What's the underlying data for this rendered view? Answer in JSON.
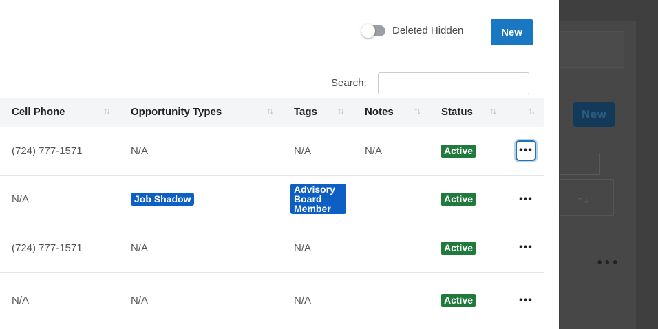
{
  "background": {
    "new_label": "New"
  },
  "toolbar": {
    "toggle_label": "Deleted Hidden",
    "new_label": "New",
    "search_label": "Search:",
    "search_value": ""
  },
  "table": {
    "headers": [
      "Cell Phone",
      "Opportunity Types",
      "Tags",
      "Notes",
      "Status",
      ""
    ],
    "rows": [
      {
        "phone": "(724) 777-1571",
        "opportunity": "N/A",
        "tags": "N/A",
        "notes": "N/A",
        "status": "Active"
      },
      {
        "phone": "N/A",
        "opportunity": "Job Shadow",
        "tags": "Advisory Board Member",
        "notes": "",
        "status": "Active"
      },
      {
        "phone": "(724) 777-1571",
        "opportunity": "N/A",
        "tags": "N/A",
        "notes": "",
        "status": "Active"
      },
      {
        "phone": "N/A",
        "opportunity": "N/A",
        "tags": "N/A",
        "notes": "",
        "status": "Active"
      }
    ],
    "actions_glyph": "•••",
    "sort_glyph": "↑↓"
  },
  "colors": {
    "primary": "#1a78c2",
    "badge_blue": "#0d5fc4",
    "status_green": "#1f7a3c"
  }
}
